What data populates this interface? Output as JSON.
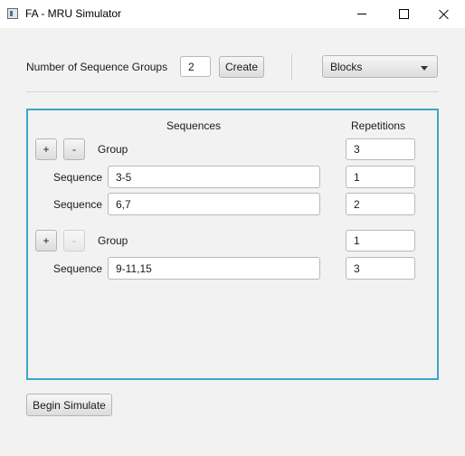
{
  "window": {
    "title": "FA - MRU Simulator",
    "icon": "app-icon",
    "controls": [
      "minimize-icon",
      "maximize-icon",
      "close-icon"
    ]
  },
  "toolbar": {
    "groups_label": "Number of Sequence Groups",
    "groups_value": "2",
    "create_label": "Create",
    "mode_selected": "Blocks"
  },
  "panel": {
    "border_color": "#3fa5c8",
    "sequences_header": "Sequences",
    "repetitions_header": "Repetitions",
    "groups": [
      {
        "add_label": "+",
        "remove_label": "-",
        "remove_enabled": true,
        "group_label": "Group",
        "repetitions": "3",
        "sequences": [
          {
            "label": "Sequence",
            "value": "3-5",
            "repetitions": "1"
          },
          {
            "label": "Sequence",
            "value": "6,7",
            "repetitions": "2"
          }
        ]
      },
      {
        "add_label": "+",
        "remove_label": "-",
        "remove_enabled": false,
        "group_label": "Group",
        "repetitions": "1",
        "sequences": [
          {
            "label": "Sequence",
            "value": "9-11,15",
            "repetitions": "3"
          }
        ]
      }
    ]
  },
  "footer": {
    "begin_label": "Begin Simulate"
  }
}
